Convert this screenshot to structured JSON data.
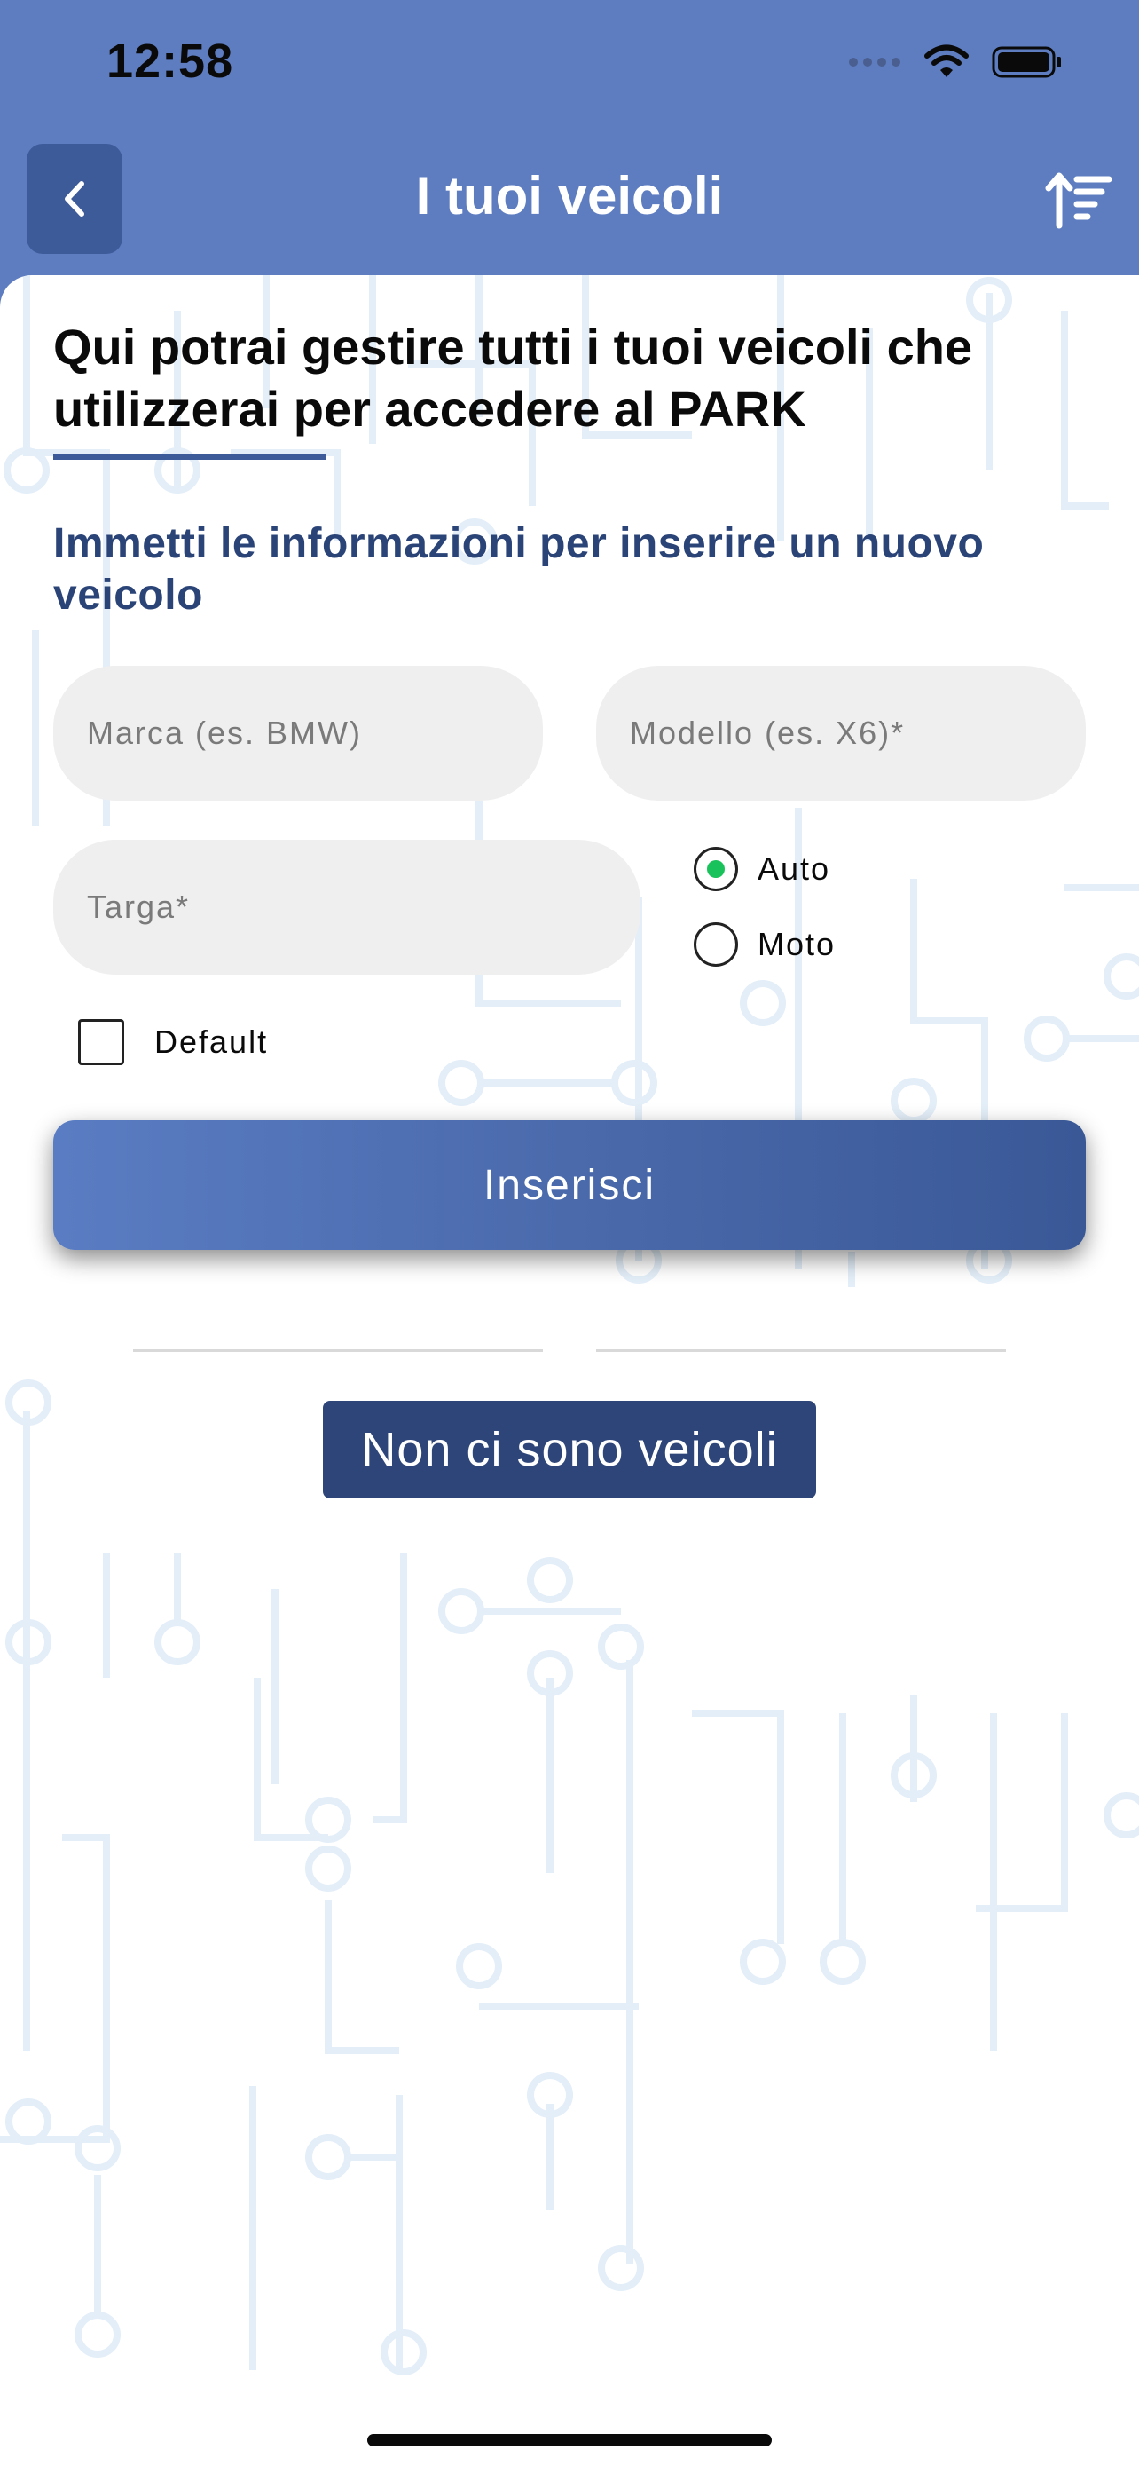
{
  "status_bar": {
    "time": "12:58"
  },
  "header": {
    "title": "I tuoi veicoli"
  },
  "intro": {
    "heading": "Qui potrai gestire tutti i tuoi veicoli che utilizzerai per accedere al PARK"
  },
  "form": {
    "instruction": "Immetti le informazioni per inserire un nuovo veicolo",
    "brand_placeholder": "Marca (es. BMW)",
    "model_placeholder": "Modello (es. X6)*",
    "plate_placeholder": "Targa*",
    "vehicle_types": [
      {
        "label": "Auto",
        "selected": true
      },
      {
        "label": "Moto",
        "selected": false
      }
    ],
    "default_label": "Default",
    "default_checked": false,
    "submit_label": "Inserisci"
  },
  "vehicles": {
    "empty_message": "Non ci sono veicoli"
  },
  "colors": {
    "header_bg": "#5e7dc0",
    "accent": "#3d5a99",
    "selected_radio": "#19c25a",
    "pattern_line": "#e3eef8"
  }
}
